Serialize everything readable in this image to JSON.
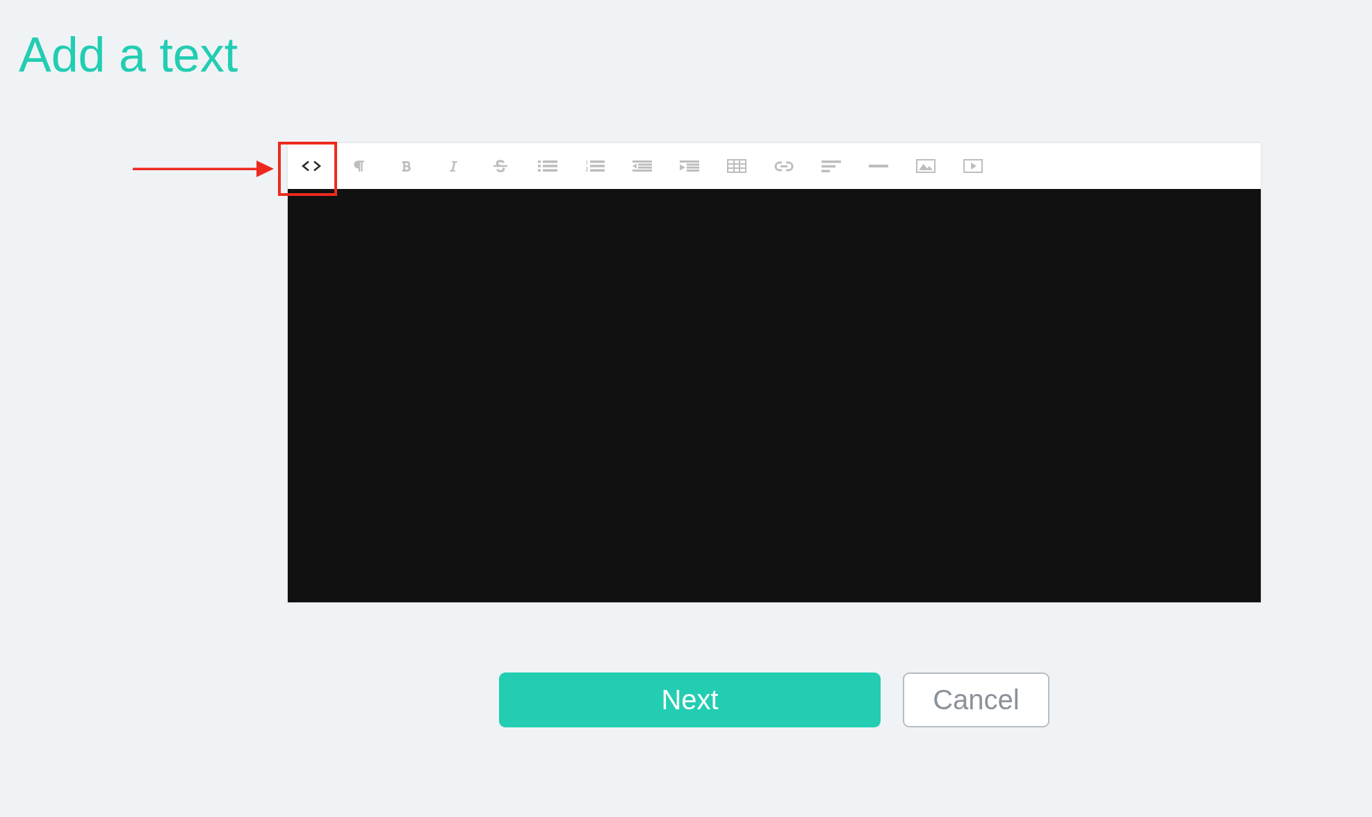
{
  "title": "Add a text",
  "editor": {
    "toolbar": [
      {
        "kind": "html",
        "disabled": false,
        "highlighted": true
      },
      {
        "kind": "paragraph",
        "disabled": true,
        "highlighted": false
      },
      {
        "kind": "bold",
        "disabled": true,
        "highlighted": false
      },
      {
        "kind": "italic",
        "disabled": true,
        "highlighted": false
      },
      {
        "kind": "strikethrough",
        "disabled": true,
        "highlighted": false
      },
      {
        "kind": "bullet-list",
        "disabled": true,
        "highlighted": false
      },
      {
        "kind": "numbered-list",
        "disabled": true,
        "highlighted": false
      },
      {
        "kind": "outdent",
        "disabled": true,
        "highlighted": false
      },
      {
        "kind": "indent",
        "disabled": true,
        "highlighted": false
      },
      {
        "kind": "table",
        "disabled": true,
        "highlighted": false
      },
      {
        "kind": "link",
        "disabled": true,
        "highlighted": false
      },
      {
        "kind": "align",
        "disabled": true,
        "highlighted": false
      },
      {
        "kind": "rule",
        "disabled": true,
        "highlighted": false
      },
      {
        "kind": "image",
        "disabled": true,
        "highlighted": false
      },
      {
        "kind": "video",
        "disabled": true,
        "highlighted": false
      }
    ]
  },
  "buttons": [
    {
      "label": "Next",
      "kind": "primary"
    },
    {
      "label": "Cancel",
      "kind": "secondary"
    }
  ]
}
